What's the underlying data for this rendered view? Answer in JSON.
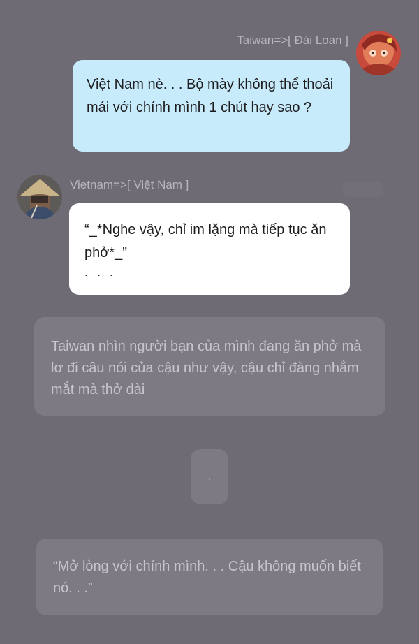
{
  "taiwan": {
    "sender_name": "Taiwan=>[ Đài Loan ]",
    "avatar_icon": "character-avatar-red",
    "message": "Việt Nam nè. . . Bộ mày không thể thoải mái với chính mình 1 chút hay sao ?"
  },
  "vietnam": {
    "sender_name": "Vietnam=>[ Việt Nam ]",
    "avatar_icon": "character-avatar-conical-hat",
    "message": "“_*Nghe vậy, chỉ im lặng mà tiếp tục ăn phở*_”",
    "trailing": ". . ."
  },
  "narration": {
    "first": "Taiwan nhìn người bạn của mình đang ăn phở mà lơ đi câu nói của cậu như vậy, cậu chỉ đàng nhắm mắt mà thở dài",
    "separator": ".",
    "second": "“Mở lòng với chính mình. . . Cậu không muốn biết nó. . .”"
  },
  "colors": {
    "background": "#6e6b75",
    "taiwan_bubble": "#c8ebfb",
    "vietnam_bubble": "#ffffff",
    "narration_box": "#7d7a83",
    "narration_text": "#c7c4cc",
    "name_text": "#b9b6c0"
  }
}
